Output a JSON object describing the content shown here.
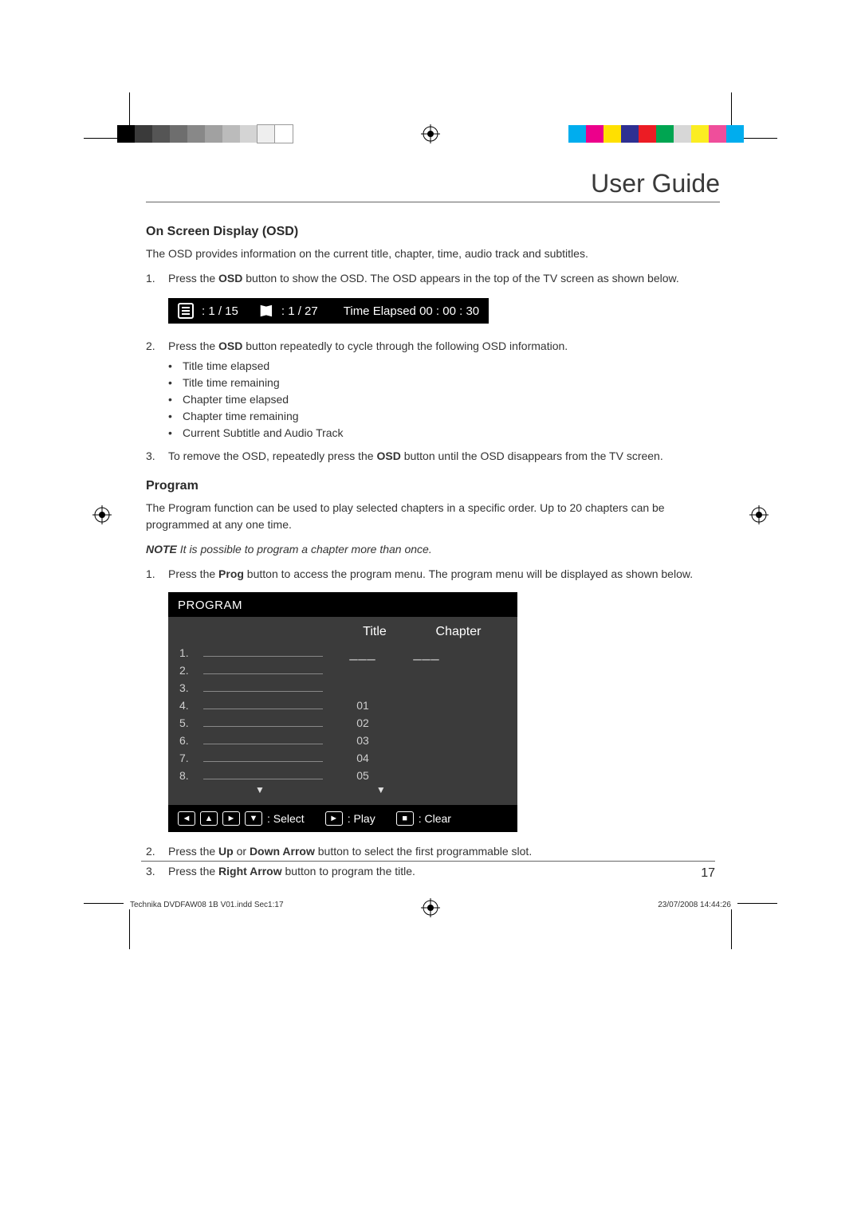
{
  "header": {
    "title": "User Guide"
  },
  "colors_left": [
    "#000000",
    "#3a3a3a",
    "#555555",
    "#6e6e6e",
    "#888888",
    "#a1a1a1",
    "#bbbbbb",
    "#d4d4d4",
    "#eeeeee",
    "#ffffff"
  ],
  "colors_right": [
    "#00adee",
    "#ef4e9b",
    "#fbed22",
    "#d7d7d7",
    "#00a551",
    "#ec1c24",
    "#2e3092",
    "#ffe000",
    "#ec008b",
    "#00adee"
  ],
  "osd": {
    "heading": "On Screen Display (OSD)",
    "intro": "The OSD provides information on the current title, chapter, time, audio track and subtitles.",
    "step1_num": "1.",
    "step1_a": "Press the ",
    "step1_bold": "OSD",
    "step1_b": " button to show the OSD. The OSD appears in the top of the TV screen as shown below.",
    "bar": {
      "title_label": ": 1 / 15",
      "chapter_label": ": 1 / 27",
      "time_label": "Time Elapsed 00 : 00 : 30"
    },
    "step2_num": "2.",
    "step2_a": "Press the ",
    "step2_bold": "OSD",
    "step2_b": " button repeatedly to cycle through the following OSD information.",
    "bullets": [
      "Title time elapsed",
      "Title time remaining",
      "Chapter time elapsed",
      "Chapter time remaining",
      "Current Subtitle and Audio Track"
    ],
    "step3_num": "3.",
    "step3_a": "To remove the OSD, repeatedly press the ",
    "step3_bold": "OSD",
    "step3_b": " button until the OSD disappears from the TV screen."
  },
  "program": {
    "heading": "Program",
    "intro": "The Program function can be used to play selected chapters in a specific order. Up to 20 chapters can be programmed at any one time.",
    "note_label": "NOTE",
    "note_text": " It is possible to program a chapter more than once.",
    "step1_num": "1.",
    "step1_a": "Press the ",
    "step1_bold": "Prog",
    "step1_b": " button to access the program menu. The program menu will be displayed as shown below.",
    "screen": {
      "title": "PROGRAM",
      "col_title": "Title",
      "col_chapter": "Chapter",
      "rows": [
        {
          "n": "1.",
          "t": "___",
          "c": "___"
        },
        {
          "n": "2.",
          "t": "",
          "c": ""
        },
        {
          "n": "3.",
          "t": "",
          "c": ""
        },
        {
          "n": "4.",
          "t": "01",
          "c": ""
        },
        {
          "n": "5.",
          "t": "02",
          "c": ""
        },
        {
          "n": "6.",
          "t": "03",
          "c": ""
        },
        {
          "n": "7.",
          "t": "04",
          "c": ""
        },
        {
          "n": "8.",
          "t": "05",
          "c": ""
        }
      ],
      "foot_select": " : Select",
      "foot_play": " : Play",
      "foot_clear": " : Clear"
    },
    "step2_num": "2.",
    "step2_a": "Press the ",
    "step2_bold1": "Up",
    "step2_mid": " or ",
    "step2_bold2": "Down Arrow",
    "step2_b": " button to select the first programmable slot.",
    "step3_num": "3.",
    "step3_a": "Press the ",
    "step3_bold": "Right Arrow",
    "step3_b": " button to program the title."
  },
  "page_number": "17",
  "print": {
    "file": "Technika DVDFAW08 1B V01.indd   Sec1:17",
    "timestamp": "23/07/2008   14:44:26"
  }
}
